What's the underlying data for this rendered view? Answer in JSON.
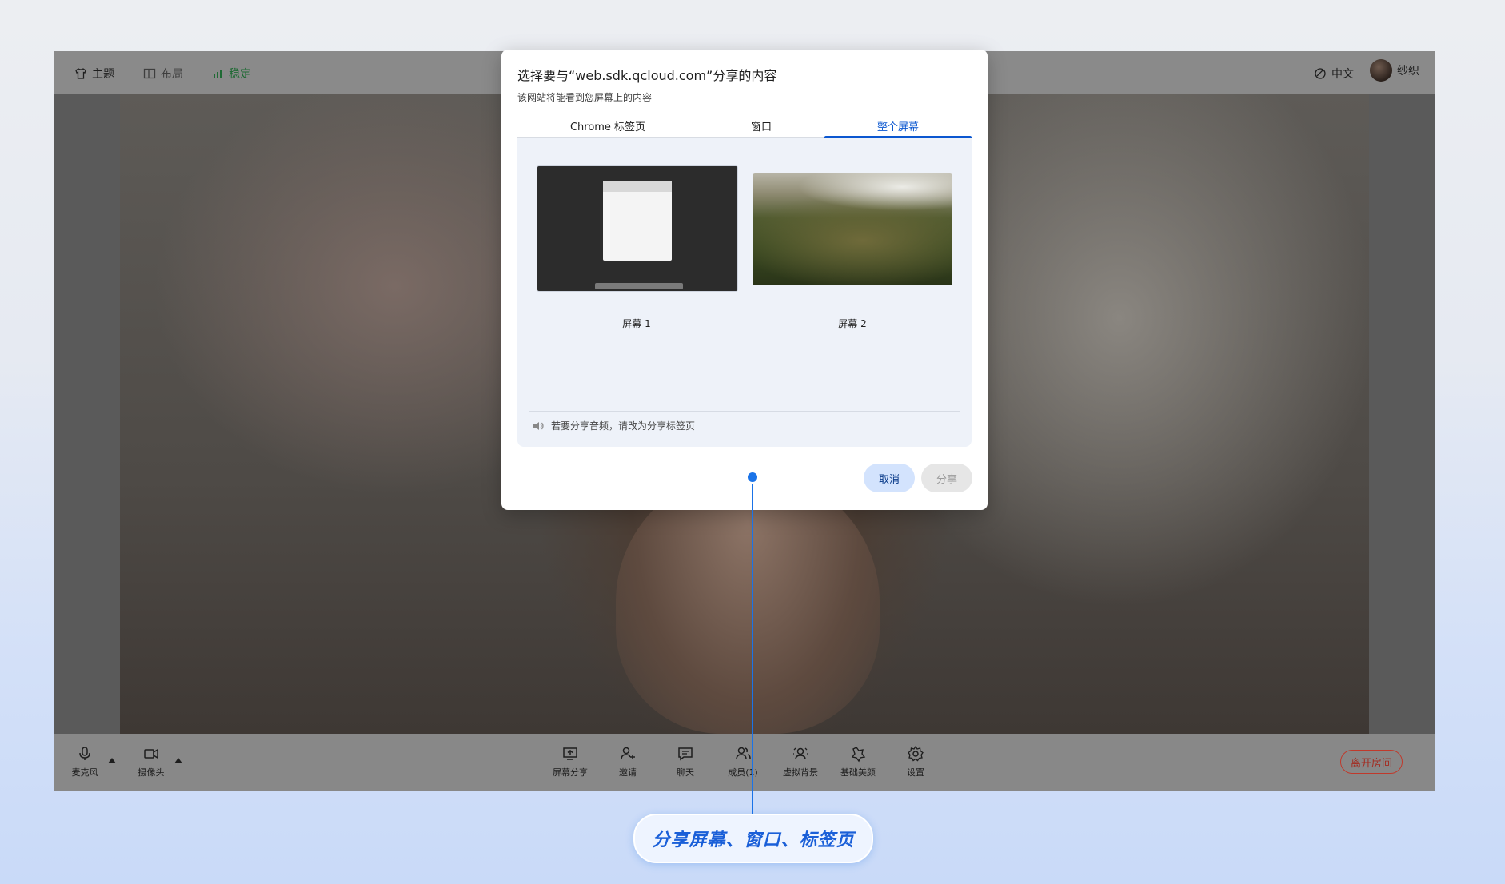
{
  "topbar": {
    "theme": "主题",
    "layout": "布局",
    "stable": "稳定",
    "language": "中文",
    "username": "纱织"
  },
  "dialog": {
    "title": "选择要与“web.sdk.qcloud.com”分享的内容",
    "subtitle": "该网站将能看到您屏幕上的内容",
    "tabs": [
      {
        "label": "Chrome 标签页",
        "active": false
      },
      {
        "label": "窗口",
        "active": false
      },
      {
        "label": "整个屏幕",
        "active": true
      }
    ],
    "screens": [
      {
        "label": "屏幕 1"
      },
      {
        "label": "屏幕 2"
      }
    ],
    "audio_note": "若要分享音频，请改为分享标签页",
    "cancel_label": "取消",
    "share_label": "分享"
  },
  "controls": {
    "microphone": "麦克风",
    "camera": "摄像头",
    "screen_share": "屏幕分享",
    "invite": "邀请",
    "chat": "聊天",
    "members": "成员(1)",
    "virtual_bg": "虚拟背景",
    "beauty": "基础美颜",
    "settings": "设置",
    "leave": "离开房间"
  },
  "callout": {
    "text": "分享屏幕、窗口、标签页"
  },
  "colors": {
    "accent": "#0b57d0",
    "callout": "#1a73e8",
    "leave": "#c0392b"
  }
}
